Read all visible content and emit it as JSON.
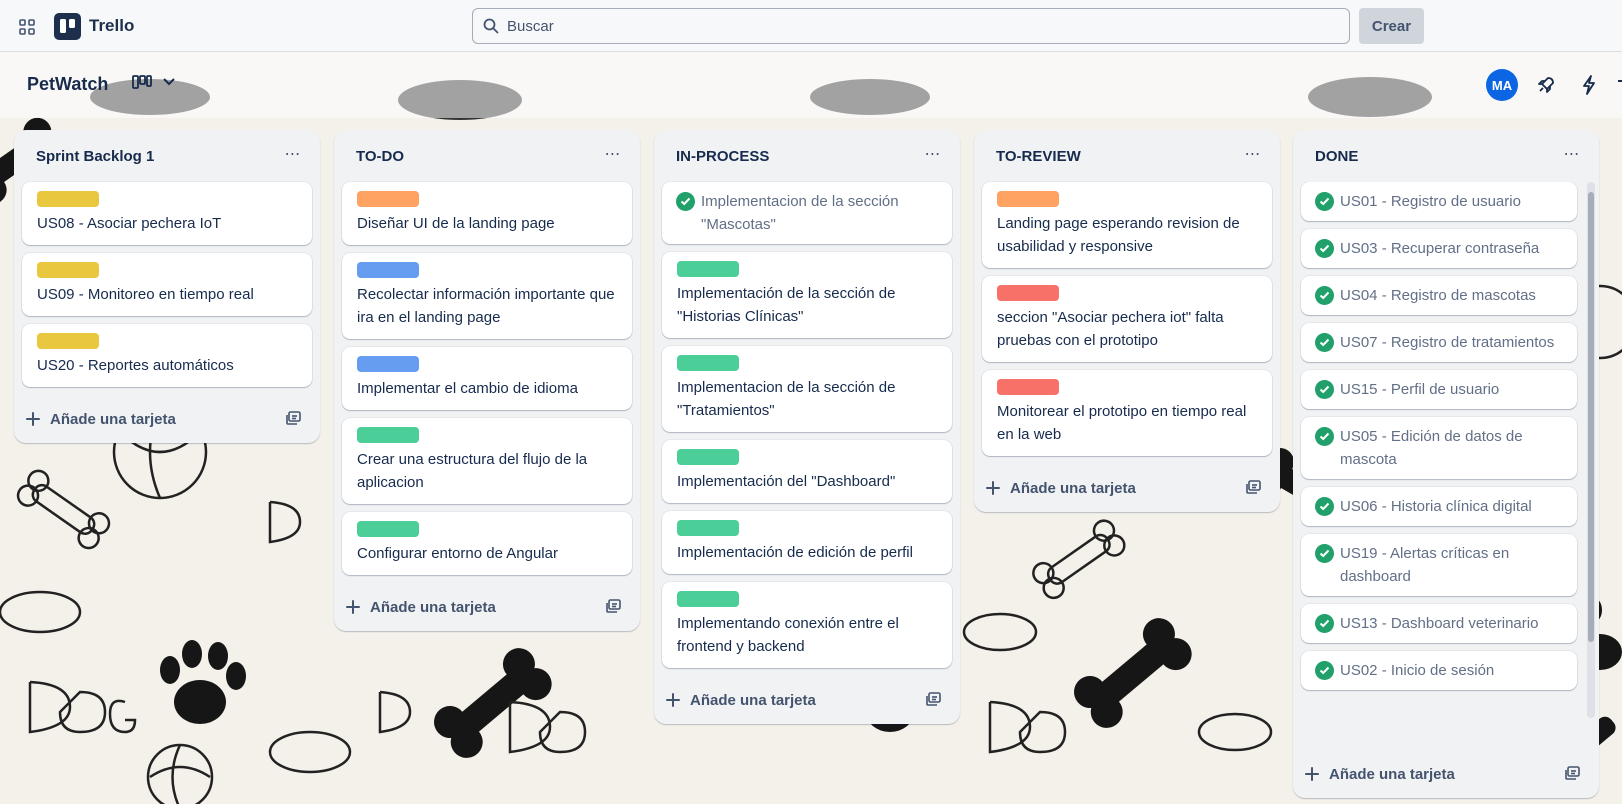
{
  "app": {
    "name": "Trello"
  },
  "search": {
    "placeholder": "Buscar"
  },
  "create_label": "Crear",
  "board": {
    "title": "PetWatch"
  },
  "user": {
    "initials": "MA"
  },
  "add_card_label": "Añade una tarjeta",
  "colors": {
    "yellow": "#e9c73f",
    "orange": "#fea362",
    "blue": "#669df1",
    "green": "#4bce97",
    "red": "#f87168"
  },
  "lists": [
    {
      "title": "Sprint Backlog 1",
      "cards": [
        {
          "label": "yellow",
          "text": "US08 - Asociar pechera IoT"
        },
        {
          "label": "yellow",
          "text": "US09 - Monitoreo en tiempo real"
        },
        {
          "label": "yellow",
          "text": "US20 - Reportes automáticos"
        }
      ]
    },
    {
      "title": "TO-DO",
      "cards": [
        {
          "label": "orange",
          "text": "Diseñar UI de la landing page"
        },
        {
          "label": "blue",
          "text": "Recolectar información importante que ira en el landing page"
        },
        {
          "label": "blue",
          "text": "Implementar el cambio de idioma"
        },
        {
          "label": "green",
          "text": "Crear una estructura del flujo de la aplicacion"
        },
        {
          "label": "green",
          "text": "Configurar entorno de Angular"
        }
      ]
    },
    {
      "title": "IN-PROCESS",
      "cards": [
        {
          "done": true,
          "text": "Implementacion de la sección \"Mascotas\""
        },
        {
          "label": "green",
          "text": "Implementación de la sección de \"Historias Clínicas\""
        },
        {
          "label": "green",
          "text": "Implementacion de la sección de \"Tratamientos\""
        },
        {
          "label": "green",
          "text": "Implementación del \"Dashboard\""
        },
        {
          "label": "green",
          "text": "Implementación de edición de perfil"
        },
        {
          "label": "green",
          "text": "Implementando conexión entre el frontend y backend"
        }
      ]
    },
    {
      "title": "TO-REVIEW",
      "cards": [
        {
          "label": "orange",
          "text": "Landing page esperando revision de usabilidad y responsive"
        },
        {
          "label": "red",
          "text": "seccion \"Asociar pechera iot\" falta pruebas con el prototipo"
        },
        {
          "label": "red",
          "text": "Monitorear el prototipo en tiempo real en la web"
        }
      ]
    },
    {
      "title": "DONE",
      "cards": [
        {
          "done": true,
          "text": "US01 - Registro de usuario"
        },
        {
          "done": true,
          "text": "US03 - Recuperar contraseña"
        },
        {
          "done": true,
          "text": "US04 - Registro de mascotas"
        },
        {
          "done": true,
          "text": "US07 - Registro de tratamientos"
        },
        {
          "done": true,
          "text": "US15 - Perfil de usuario"
        },
        {
          "done": true,
          "text": "US05 - Edición de datos de mascota"
        },
        {
          "done": true,
          "text": "US06 - Historia clínica digital"
        },
        {
          "done": true,
          "text": "US19 - Alertas críticas en dashboard"
        },
        {
          "done": true,
          "text": "US13 - Dashboard veterinario"
        },
        {
          "done": true,
          "text": "US02 - Inicio de sesión"
        }
      ]
    }
  ]
}
